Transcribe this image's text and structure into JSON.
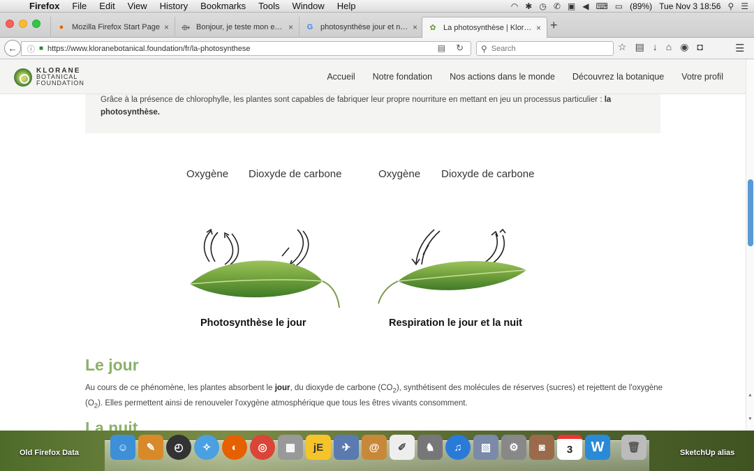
{
  "menubar": {
    "app": "Firefox",
    "items": [
      "File",
      "Edit",
      "View",
      "History",
      "Bookmarks",
      "Tools",
      "Window",
      "Help"
    ],
    "battery": "(89%)",
    "clock": "Tue Nov 3  18:56"
  },
  "tabs": [
    {
      "title": "Mozilla Firefox Start Page"
    },
    {
      "title": "Bonjour, je teste mon eau ..."
    },
    {
      "title": "photosynthèse jour et nui..."
    },
    {
      "title": "La photosynthèse | Kloran..."
    }
  ],
  "navbar": {
    "url": "https://www.kloranebotanical.foundation/fr/la-photosynthese",
    "search_placeholder": "Search"
  },
  "site": {
    "logo_line1": "KLORANE",
    "logo_line2": "BOTANICAL",
    "logo_line3": "FOUNDATION",
    "nav": [
      "Accueil",
      "Notre fondation",
      "Nos actions dans le monde",
      "Découvrez la botanique",
      "Votre profil"
    ],
    "intro_text": "Grâce à la présence de chlorophylle, les plantes sont capables de fabriquer leur propre nourriture en mettant en jeu un processus particulier : ",
    "intro_bold": "la photosynthèse.",
    "diagram": {
      "oxygen_label_1": "Oxygène",
      "co2_label_1": "Dioxyde de carbone",
      "oxygen_label_2": "Oxygène",
      "co2_label_2": "Dioxyde de carbone",
      "caption_left": "Photosynthèse le jour",
      "caption_right": "Respiration le jour et la nuit"
    },
    "section1_title": "Le jour",
    "section1_p1": "Au cours de ce phénomène, les plantes absorbent le ",
    "section1_bold": "jour",
    "section1_p2": ", du dioxyde de carbone (CO",
    "section1_sub1": "2",
    "section1_p3": "), synthétisent des molécules de réserves (sucres) et rejettent de l'oxygène (O",
    "section1_sub2": "2",
    "section1_p4": "). Elles permettent ainsi de renouveler l'oxygène atmosphérique que tous les êtres vivants consomment.",
    "section2_title": "La nuit"
  },
  "desktop": {
    "left_label": "Old Firefox Data",
    "right_label": "SketchUp alias",
    "calendar_day": "3"
  },
  "colors": {
    "accent_green": "#8bb06a",
    "scroll_thumb": "#5a9ad6"
  }
}
